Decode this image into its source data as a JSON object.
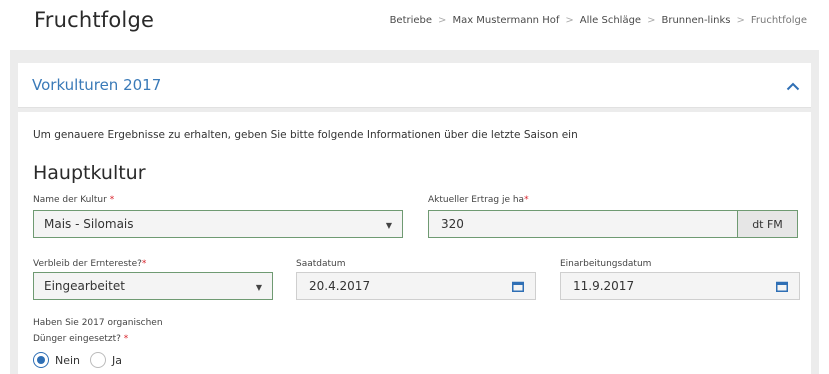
{
  "page": {
    "title": "Fruchtfolge"
  },
  "breadcrumb": [
    "Betriebe",
    "Max Mustermann Hof",
    "Alle Schläge",
    "Brunnen-links",
    "Fruchtfolge"
  ],
  "breadcrumb_separator": ">",
  "panel": {
    "title": "Vorkulturen 2017",
    "collapse_icon": "chevron-up-icon"
  },
  "info_text": "Um genauere Ergebnisse zu erhalten, geben Sie bitte folgende Informationen über die letzte Saison ein",
  "section_title": "Hauptkultur",
  "required_mark": "*",
  "fields": {
    "kultur": {
      "label": "Name der Kultur ",
      "value": "Mais - Silomais"
    },
    "ertrag": {
      "label": "Aktueller Ertrag je ha",
      "value": "320",
      "unit": "dt FM"
    },
    "verbleib": {
      "label": "Verbleib der Erntereste?",
      "value": "Eingearbeitet"
    },
    "saatdatum": {
      "label": "Saatdatum",
      "value": "20.4.2017"
    },
    "einarbeitung": {
      "label": "Einarbeitungsdatum",
      "value": "11.9.2017"
    },
    "duenger": {
      "label_line1": "Haben Sie 2017 organischen",
      "label_line2": "Dünger eingesetzt? ",
      "options": [
        "Nein",
        "Ja"
      ],
      "selected": "Nein"
    }
  },
  "colors": {
    "accent": "#2f6fb5",
    "field_border": "#6f9a72",
    "required": "#d9232b"
  }
}
